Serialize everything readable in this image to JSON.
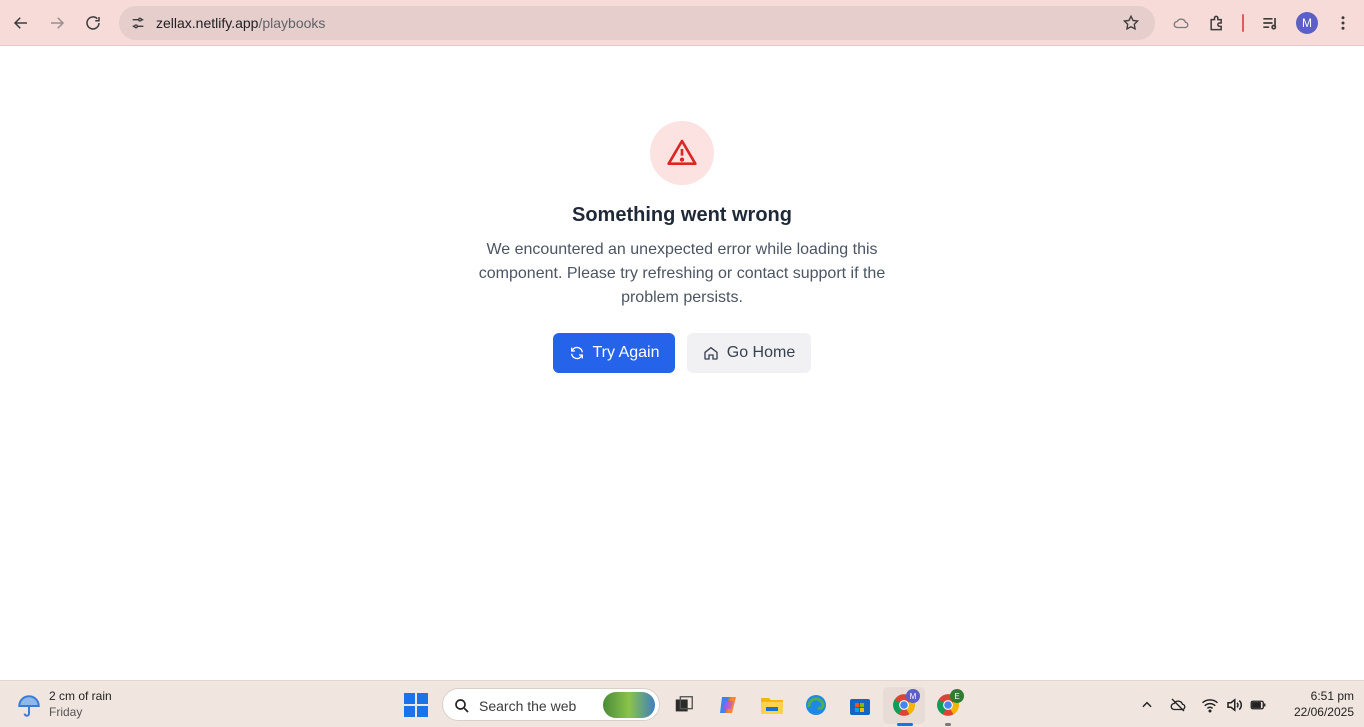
{
  "browser": {
    "url_host": "zellax.netlify.app",
    "url_path": "/playbooks",
    "profile_initial": "M"
  },
  "error": {
    "title": "Something went wrong",
    "message": "We encountered an unexpected error while loading this component. Please try refreshing or contact support if the problem persists.",
    "primary_label": "Try Again",
    "secondary_label": "Go Home",
    "accent_color": "#2563eb",
    "danger_color": "#dc2626"
  },
  "taskbar": {
    "weather_text": "2 cm of rain",
    "weather_day": "Friday",
    "search_placeholder": "Search the web",
    "chrome_badge_1": "M",
    "chrome_badge_2": "E",
    "time": "6:51 pm",
    "date": "22/06/2025"
  }
}
